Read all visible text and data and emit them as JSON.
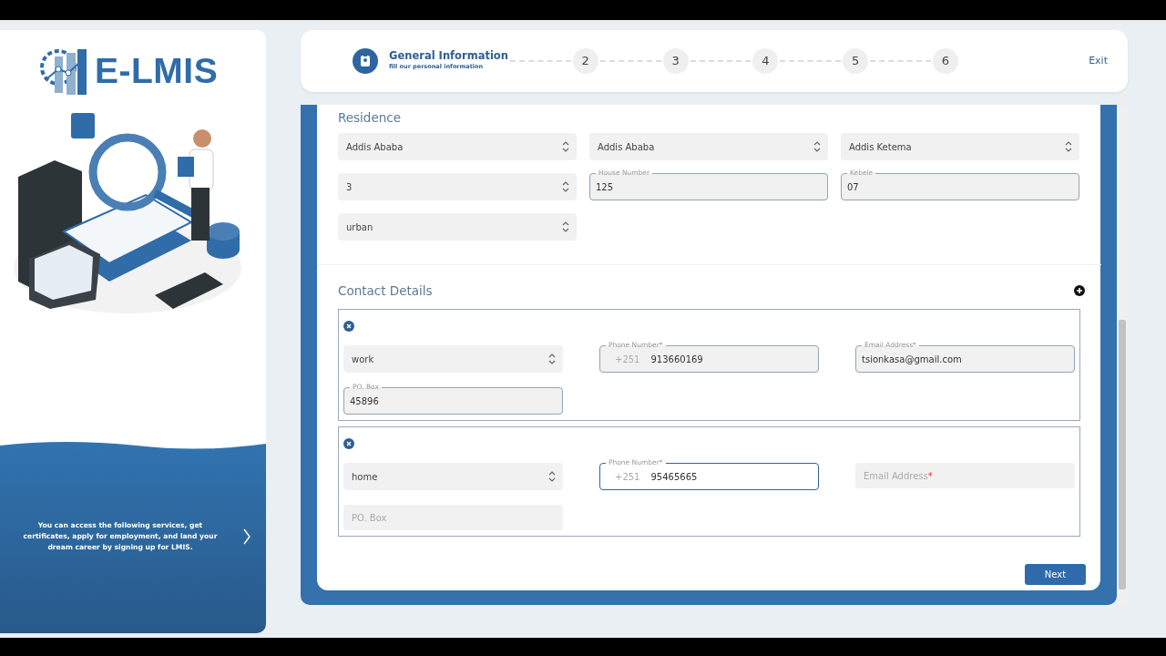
{
  "sidebar": {
    "logo": {
      "text": "E-LMIS"
    },
    "promo": {
      "text": "You can access the following services, get certificates, apply for employment, and land your dream career by signing up for LMIS."
    }
  },
  "stepper": {
    "steps": [
      {
        "kind": "icon",
        "title": "General Information",
        "subtitle": "fill our personal information",
        "selected": true
      },
      {
        "kind": "number",
        "number": "2",
        "selected": false
      },
      {
        "kind": "number",
        "number": "3",
        "selected": false
      },
      {
        "kind": "number",
        "number": "4",
        "selected": false
      },
      {
        "kind": "number",
        "number": "5",
        "selected": false
      },
      {
        "kind": "number",
        "number": "6",
        "selected": false
      }
    ],
    "exit": "Exit"
  },
  "residence": {
    "title": "Residence",
    "fields": [
      {
        "kind": "select",
        "value": "Addis Ababa"
      },
      {
        "kind": "select",
        "value": "Addis Ababa"
      },
      {
        "kind": "select",
        "value": "Addis Ketema"
      },
      {
        "kind": "select",
        "value": "3"
      },
      {
        "kind": "input",
        "label": "House Number",
        "value": "125"
      },
      {
        "kind": "input",
        "label": "Kebele",
        "value": "07"
      },
      {
        "kind": "select",
        "value": "urban"
      }
    ]
  },
  "contact_details": {
    "title": "Contact Details",
    "contacts": [
      {
        "type": "work",
        "phone": {
          "label": "Phone Number*",
          "prefix": "+251",
          "value": "913660169",
          "focused": false
        },
        "email": {
          "label": "Email Address*",
          "value": "tsionkasa@gmail.com"
        },
        "po_box": {
          "label": "PO. Box",
          "value": "45896"
        }
      },
      {
        "type": "home",
        "phone": {
          "label": "Phone Number*",
          "prefix": "+251",
          "value": "95465665",
          "focused": true
        },
        "email": {
          "placeholder": "Email Address",
          "required_mark": "*"
        },
        "po_box": {
          "placeholder": "PO. Box"
        }
      }
    ]
  },
  "next_button": "Next"
}
